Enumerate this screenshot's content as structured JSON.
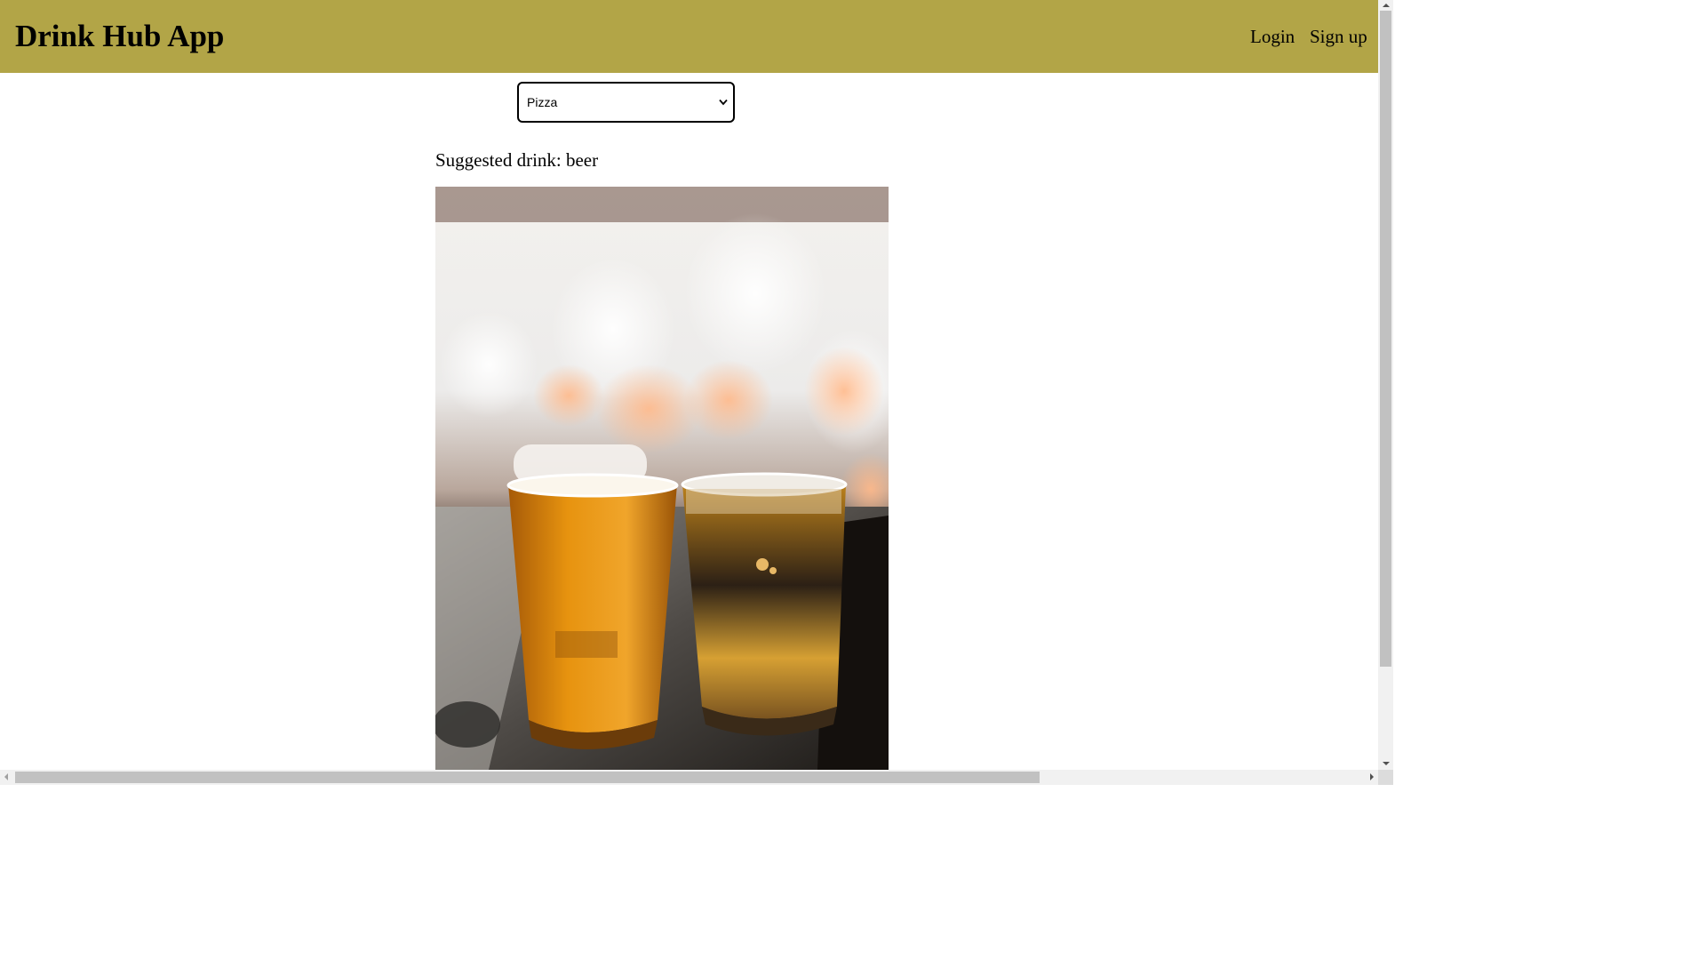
{
  "header": {
    "app_title": "Drink Hub App",
    "login_label": "Login",
    "signup_label": "Sign up",
    "background_color": "#b2a547"
  },
  "food_select": {
    "selected_value": "Pizza",
    "icon": "chevron-down-icon"
  },
  "suggestion": {
    "text": "Suggested drink: beer"
  },
  "drink_image": {
    "subject": "beer"
  },
  "scrollbars": {
    "vertical": true,
    "horizontal": true
  }
}
